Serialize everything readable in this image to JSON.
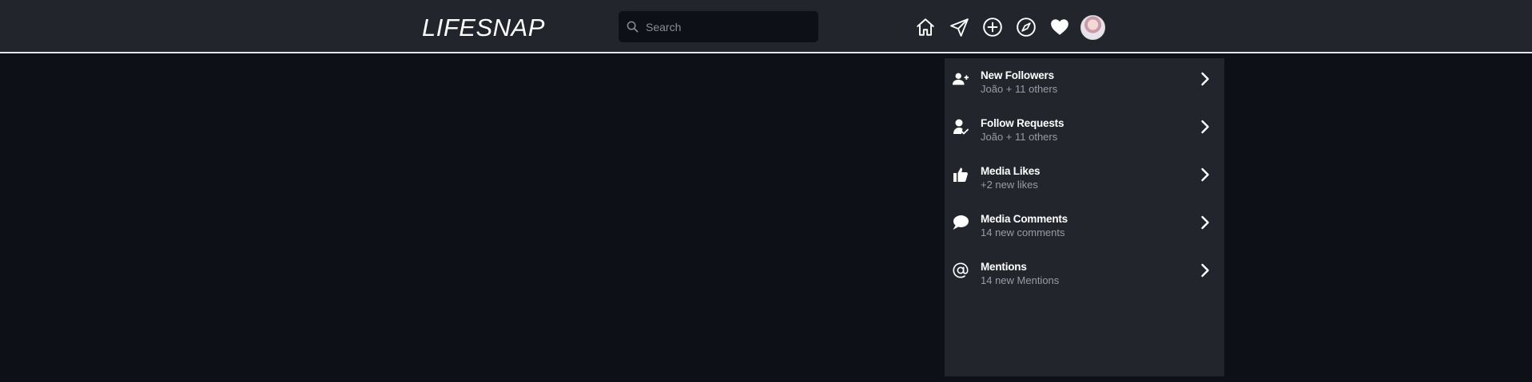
{
  "header": {
    "logo": "LIFESNAP",
    "search": {
      "placeholder": "Search",
      "value": ""
    },
    "nav_icons": [
      "home-icon",
      "send-icon",
      "add-circle-icon",
      "compass-icon",
      "heart-icon"
    ],
    "avatar": "avatar"
  },
  "notifications": {
    "items": [
      {
        "title": "New Followers",
        "subtitle": "João + 11 others",
        "icon": "user-plus-icon"
      },
      {
        "title": "Follow Requests",
        "subtitle": "João + 11 others",
        "icon": "user-check-icon"
      },
      {
        "title": "Media Likes",
        "subtitle": "+2 new likes",
        "icon": "thumbs-up-icon"
      },
      {
        "title": "Media Comments",
        "subtitle": "14 new comments",
        "icon": "comment-icon"
      },
      {
        "title": "Mentions",
        "subtitle": "14 new Mentions",
        "icon": "at-icon"
      }
    ]
  },
  "colors": {
    "background": "#0d1017",
    "topbar": "#22252c",
    "panel": "#22252c",
    "text": "#ffffff",
    "muted": "#9a9ca1"
  }
}
